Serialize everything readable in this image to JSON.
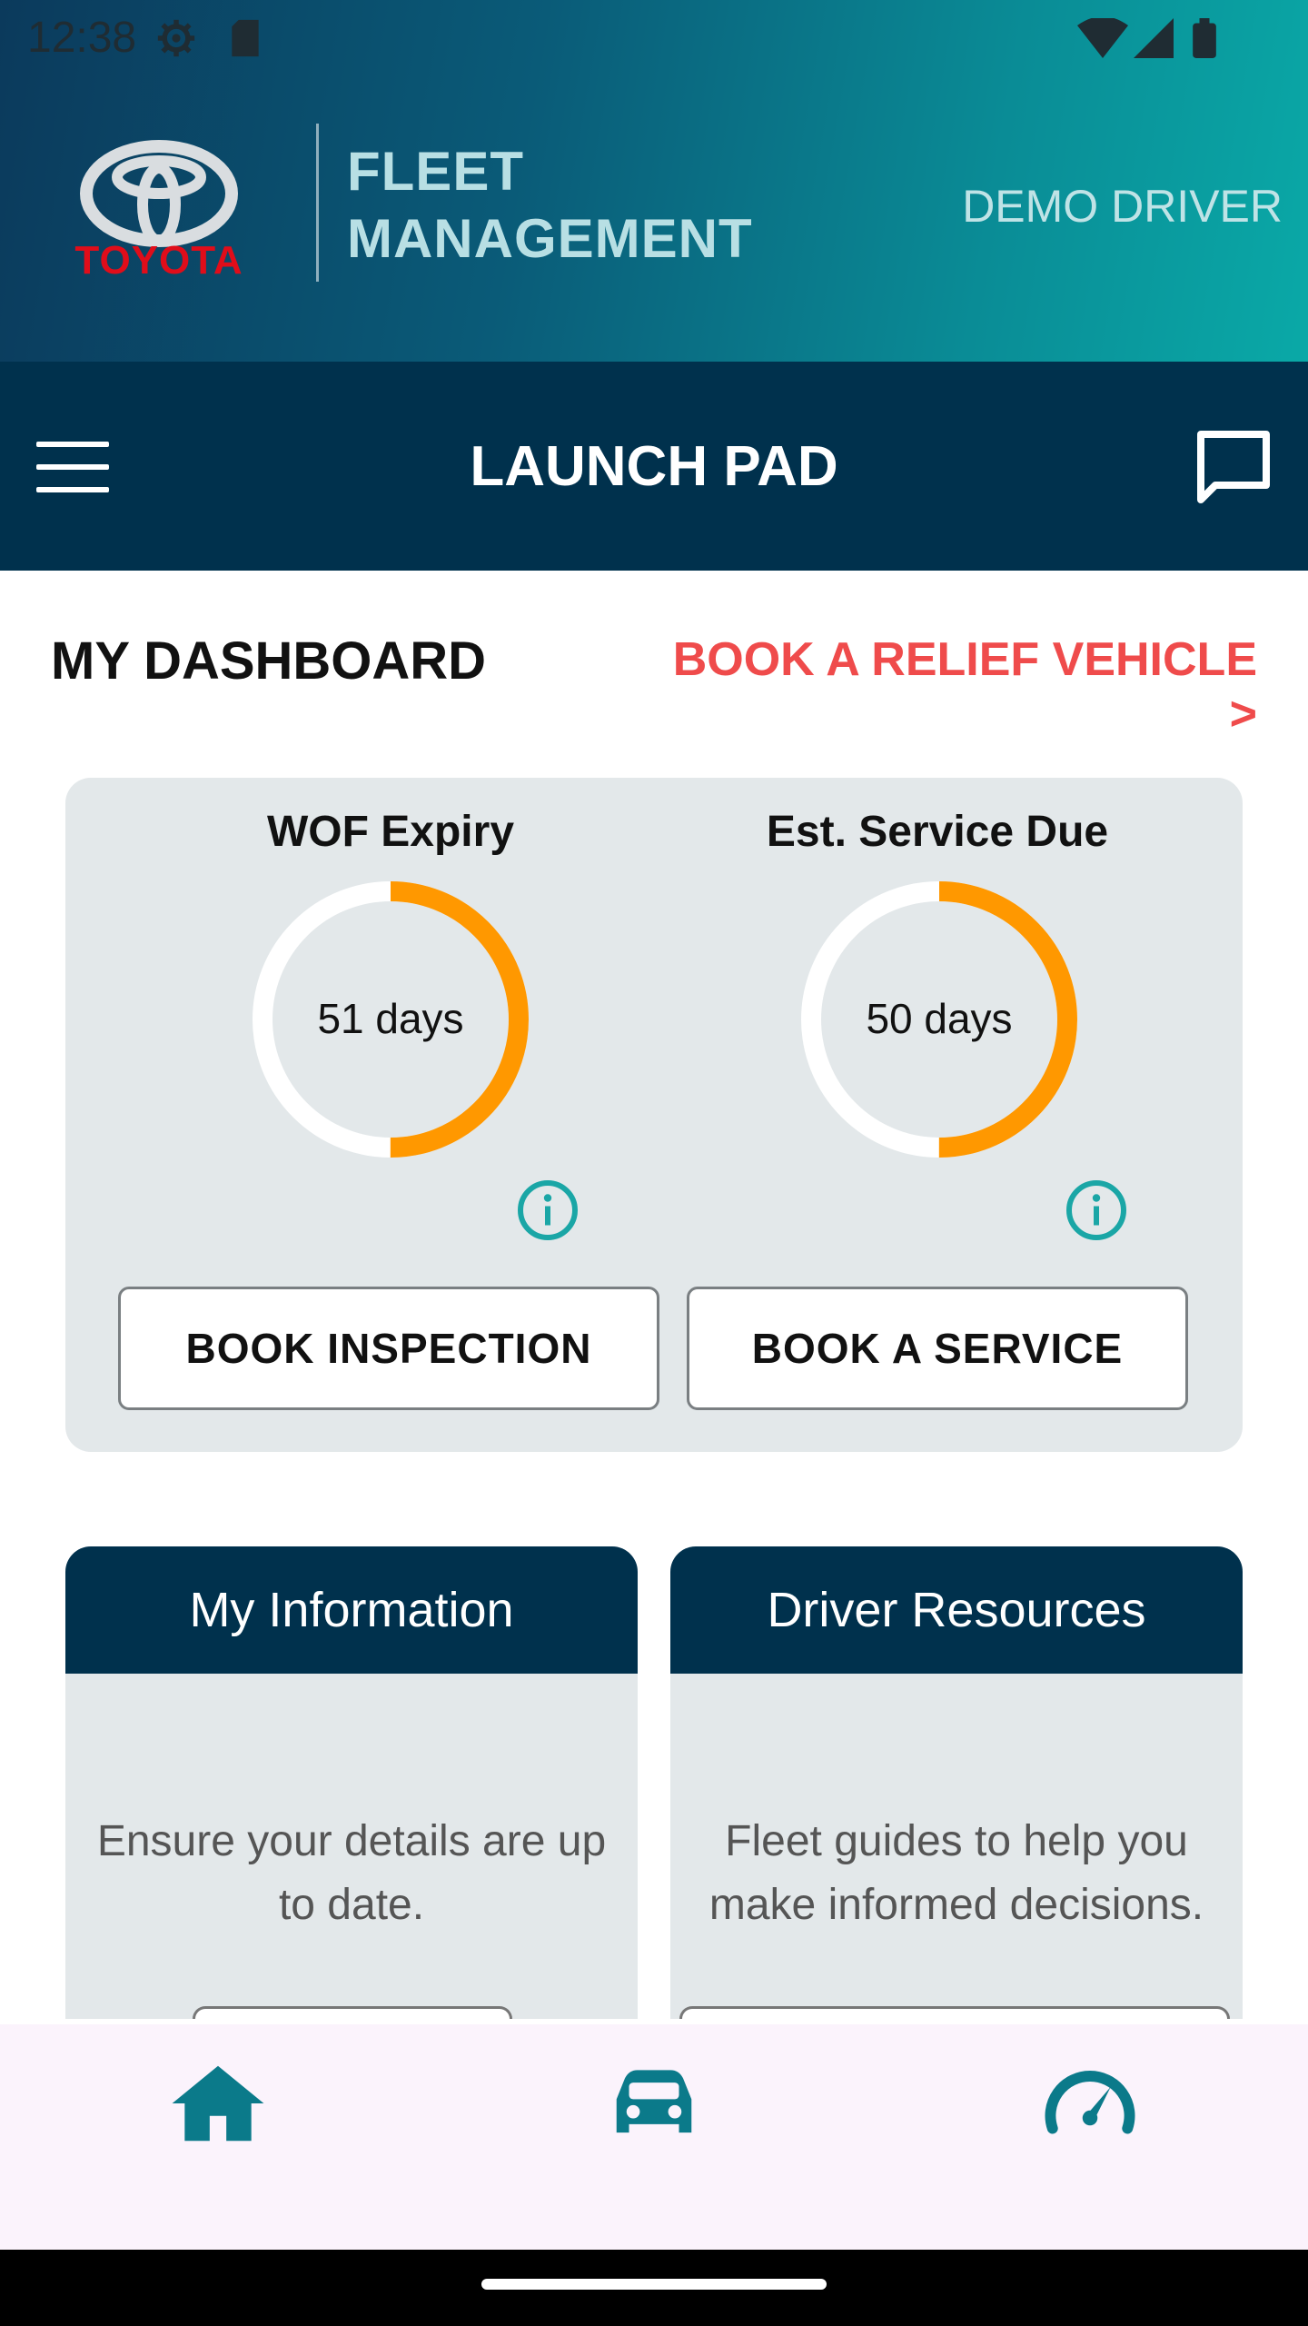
{
  "status_bar": {
    "time": "12:38",
    "icons": [
      "settings-icon",
      "sd-card-icon",
      "wifi-icon",
      "signal-icon",
      "battery-icon"
    ]
  },
  "header": {
    "brand": "TOYOTA",
    "app_title": "FLEET MANAGEMENT",
    "user": "DEMO DRIVER"
  },
  "navbar": {
    "title": "LAUNCH PAD",
    "left_icon": "menu-icon",
    "right_icon": "chat-icon"
  },
  "dashboard": {
    "title": "MY DASHBOARD",
    "relief_link": "BOOK A RELIEF VEHICLE >",
    "gauges": [
      {
        "label": "WOF Expiry",
        "value": "51 days",
        "fraction": 0.5,
        "button": "BOOK INSPECTION"
      },
      {
        "label": "Est. Service Due",
        "value": "50 days",
        "fraction": 0.5,
        "button": "BOOK A SERVICE"
      }
    ]
  },
  "cards": [
    {
      "title": "My Information",
      "body": "Ensure your details are up to date."
    },
    {
      "title": "Driver Resources",
      "body": "Fleet guides to help you make informed decisions."
    }
  ],
  "bottom_nav": {
    "items": [
      "home-icon",
      "car-icon",
      "speedometer-icon"
    ]
  },
  "colors": {
    "navy": "#00314d",
    "teal": "#0a8c96",
    "accent_red": "#ef4b4b",
    "gauge_orange": "#ff9800",
    "icon_teal": "#1aa6a6"
  }
}
